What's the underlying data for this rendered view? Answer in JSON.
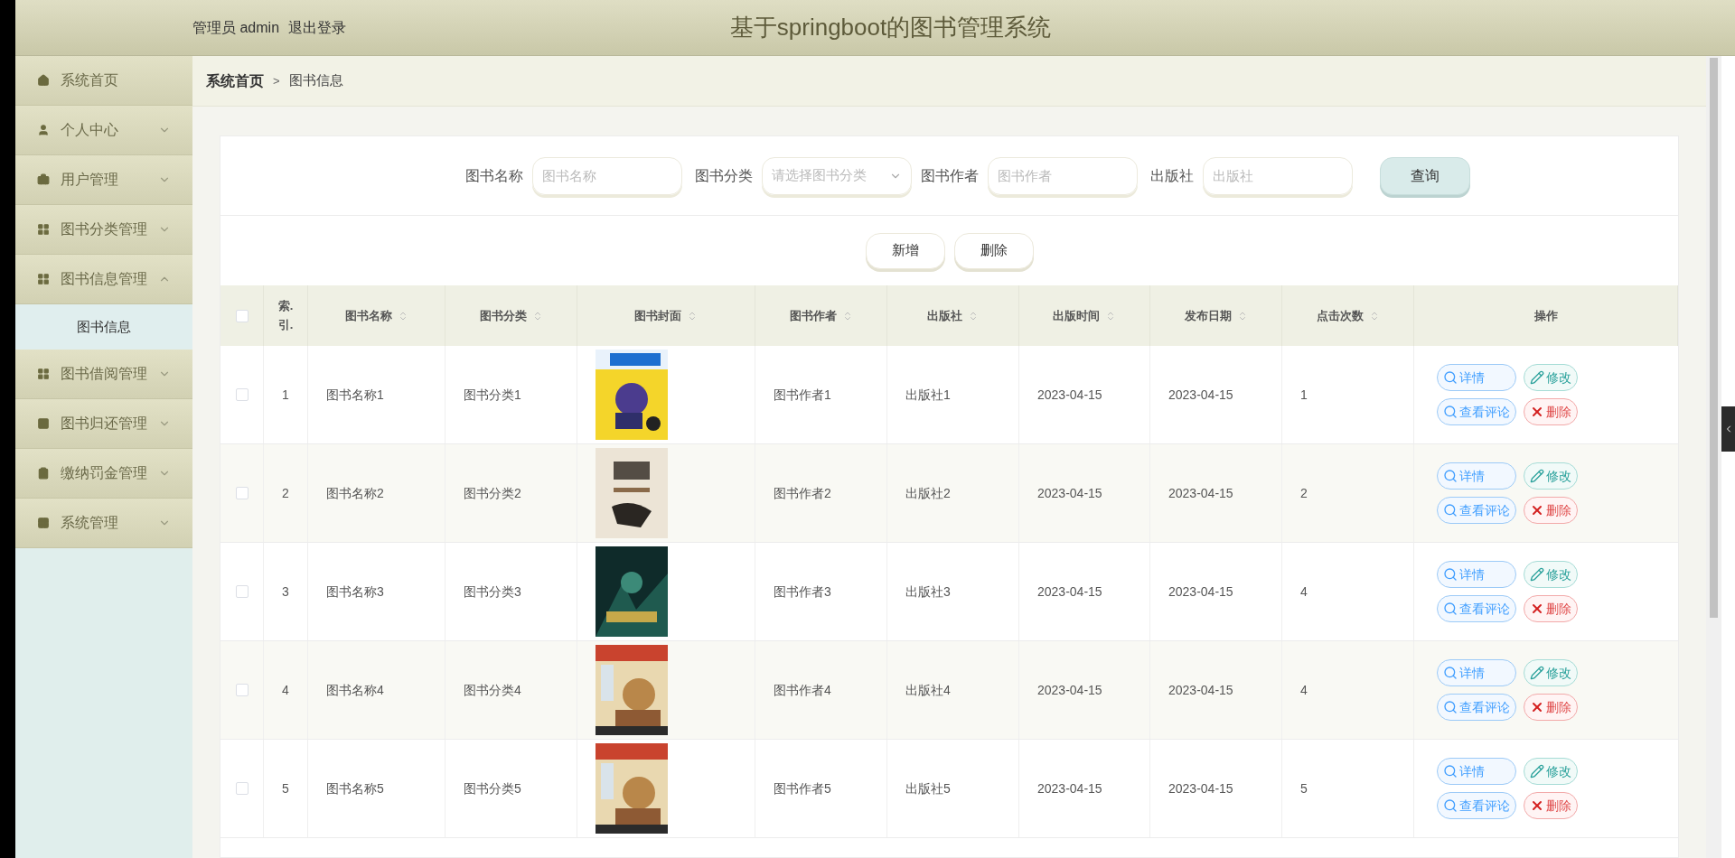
{
  "header": {
    "user_label": "管理员 admin",
    "logout": "退出登录",
    "title": "基于springboot的图书管理系统"
  },
  "sidebar": {
    "items": [
      {
        "label": "系统首页",
        "kind": "link"
      },
      {
        "label": "个人中心",
        "kind": "menu",
        "expanded": false
      },
      {
        "label": "用户管理",
        "kind": "menu",
        "expanded": false
      },
      {
        "label": "图书分类管理",
        "kind": "menu",
        "expanded": false
      },
      {
        "label": "图书信息管理",
        "kind": "menu",
        "expanded": true,
        "children": [
          {
            "label": "图书信息"
          }
        ]
      },
      {
        "label": "图书借阅管理",
        "kind": "menu",
        "expanded": false
      },
      {
        "label": "图书归还管理",
        "kind": "menu",
        "expanded": false
      },
      {
        "label": "缴纳罚金管理",
        "kind": "menu",
        "expanded": false
      },
      {
        "label": "系统管理",
        "kind": "menu",
        "expanded": false
      }
    ]
  },
  "breadcrumb": {
    "home": "系统首页",
    "separator": ">",
    "current": "图书信息"
  },
  "search": {
    "fields": [
      {
        "label": "图书名称",
        "placeholder": "图书名称",
        "kind": "input"
      },
      {
        "label": "图书分类",
        "placeholder": "请选择图书分类",
        "kind": "select"
      },
      {
        "label": "图书作者",
        "placeholder": "图书作者",
        "kind": "input"
      },
      {
        "label": "出版社",
        "placeholder": "出版社",
        "kind": "input"
      }
    ],
    "button": "查询"
  },
  "actions": [
    "新增",
    "删除"
  ],
  "table": {
    "select_all_checked": false,
    "columns": [
      {
        "label": "索.引.",
        "sortable": false
      },
      {
        "label": "图书名称",
        "sortable": true
      },
      {
        "label": "图书分类",
        "sortable": true
      },
      {
        "label": "图书封面",
        "sortable": true
      },
      {
        "label": "图书作者",
        "sortable": true
      },
      {
        "label": "出版社",
        "sortable": true
      },
      {
        "label": "出版时间",
        "sortable": true
      },
      {
        "label": "发布日期",
        "sortable": true
      },
      {
        "label": "点击次数",
        "sortable": true
      },
      {
        "label": "操作",
        "sortable": false
      }
    ],
    "rows": [
      {
        "checked": false,
        "index": "1",
        "name": "图书名称1",
        "category": "图书分类1",
        "cover": {
          "kind": "picture"
        },
        "author": "图书作者1",
        "publisher": "出版社1",
        "published": "2023-04-15",
        "released": "2023-04-15",
        "clicks": "1",
        "actions": [
          {
            "label": "详情",
            "kind": "detail"
          },
          {
            "label": "修改",
            "kind": "edit"
          },
          {
            "label": "查看评论",
            "kind": "comments"
          },
          {
            "label": "删除",
            "kind": "delete"
          }
        ]
      },
      {
        "checked": false,
        "index": "2",
        "name": "图书名称2",
        "category": "图书分类2",
        "cover": {
          "kind": "picture"
        },
        "author": "图书作者2",
        "publisher": "出版社2",
        "published": "2023-04-15",
        "released": "2023-04-15",
        "clicks": "2",
        "actions": [
          {
            "label": "详情",
            "kind": "detail"
          },
          {
            "label": "修改",
            "kind": "edit"
          },
          {
            "label": "查看评论",
            "kind": "comments"
          },
          {
            "label": "删除",
            "kind": "delete"
          }
        ]
      },
      {
        "checked": false,
        "index": "3",
        "name": "图书名称3",
        "category": "图书分类3",
        "cover": {
          "kind": "picture"
        },
        "author": "图书作者3",
        "publisher": "出版社3",
        "published": "2023-04-15",
        "released": "2023-04-15",
        "clicks": "4",
        "actions": [
          {
            "label": "详情",
            "kind": "detail"
          },
          {
            "label": "修改",
            "kind": "edit"
          },
          {
            "label": "查看评论",
            "kind": "comments"
          },
          {
            "label": "删除",
            "kind": "delete"
          }
        ]
      },
      {
        "checked": false,
        "index": "4",
        "name": "图书名称4",
        "category": "图书分类4",
        "cover": {
          "kind": "picture"
        },
        "author": "图书作者4",
        "publisher": "出版社4",
        "published": "2023-04-15",
        "released": "2023-04-15",
        "clicks": "4",
        "actions": [
          {
            "label": "详情",
            "kind": "detail"
          },
          {
            "label": "修改",
            "kind": "edit"
          },
          {
            "label": "查看评论",
            "kind": "comments"
          },
          {
            "label": "删除",
            "kind": "delete"
          }
        ]
      },
      {
        "checked": false,
        "index": "5",
        "name": "图书名称5",
        "category": "图书分类5",
        "cover": {
          "kind": "picture"
        },
        "author": "图书作者5",
        "publisher": "出版社5",
        "published": "2023-04-15",
        "released": "2023-04-15",
        "clicks": "5",
        "actions": [
          {
            "label": "详情",
            "kind": "detail"
          },
          {
            "label": "修改",
            "kind": "edit"
          },
          {
            "label": "查看评论",
            "kind": "comments"
          },
          {
            "label": "删除",
            "kind": "delete"
          }
        ]
      }
    ]
  }
}
